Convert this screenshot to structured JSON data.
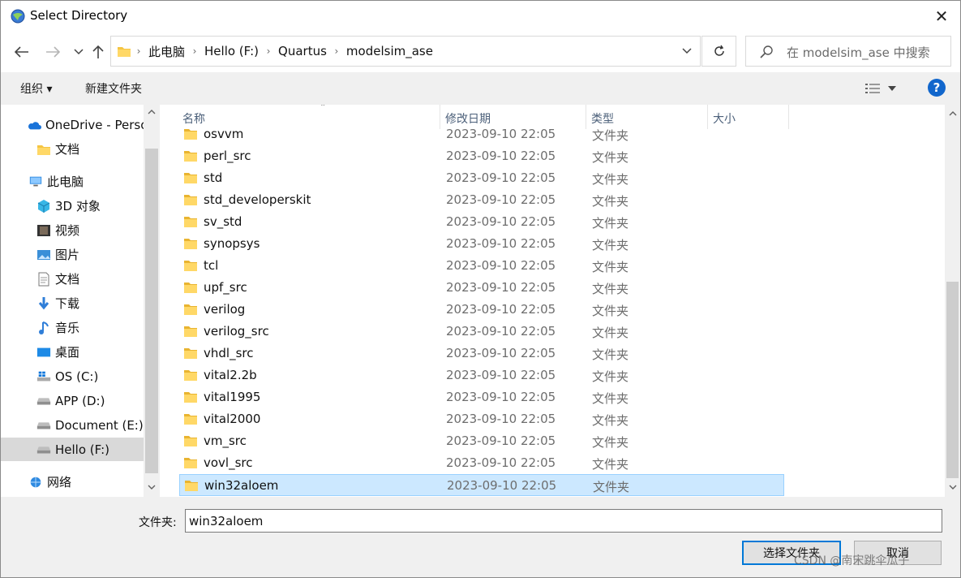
{
  "window": {
    "title": "Select Directory",
    "close_glyph": "✕"
  },
  "address": {
    "crumbs": [
      "此电脑",
      "Hello (F:)",
      "Quartus",
      "modelsim_ase"
    ],
    "separator": "›"
  },
  "search": {
    "placeholder": "在 modelsim_ase 中搜索"
  },
  "command_bar": {
    "organize_label": "组织 ▾",
    "new_folder_label": "新建文件夹",
    "help_glyph": "?"
  },
  "sidebar": {
    "items": [
      {
        "label": "OneDrive - Perso",
        "icon": "onedrive-icon"
      },
      {
        "label": "文档",
        "icon": "folder-icon"
      },
      {
        "label": "此电脑",
        "icon": "this-pc-icon"
      },
      {
        "label": "3D 对象",
        "icon": "3d-objects-icon"
      },
      {
        "label": "视频",
        "icon": "videos-icon"
      },
      {
        "label": "图片",
        "icon": "pictures-icon"
      },
      {
        "label": "文档",
        "icon": "documents-icon"
      },
      {
        "label": "下载",
        "icon": "downloads-icon"
      },
      {
        "label": "音乐",
        "icon": "music-icon"
      },
      {
        "label": "桌面",
        "icon": "desktop-icon"
      },
      {
        "label": "OS (C:)",
        "icon": "windows-drive-icon"
      },
      {
        "label": "APP (D:)",
        "icon": "drive-icon"
      },
      {
        "label": "Document (E:)",
        "icon": "drive-icon"
      },
      {
        "label": "Hello (F:)",
        "icon": "drive-icon",
        "selected": true
      },
      {
        "label": "网络",
        "icon": "network-icon"
      }
    ]
  },
  "columns": {
    "name": "名称",
    "date": "修改日期",
    "type": "类型",
    "size": "大小"
  },
  "files": [
    {
      "name": "osvvm",
      "date": "2023-09-10 22:05",
      "type": "文件夹"
    },
    {
      "name": "perl_src",
      "date": "2023-09-10 22:05",
      "type": "文件夹"
    },
    {
      "name": "std",
      "date": "2023-09-10 22:05",
      "type": "文件夹"
    },
    {
      "name": "std_developerskit",
      "date": "2023-09-10 22:05",
      "type": "文件夹"
    },
    {
      "name": "sv_std",
      "date": "2023-09-10 22:05",
      "type": "文件夹"
    },
    {
      "name": "synopsys",
      "date": "2023-09-10 22:05",
      "type": "文件夹"
    },
    {
      "name": "tcl",
      "date": "2023-09-10 22:05",
      "type": "文件夹"
    },
    {
      "name": "upf_src",
      "date": "2023-09-10 22:05",
      "type": "文件夹"
    },
    {
      "name": "verilog",
      "date": "2023-09-10 22:05",
      "type": "文件夹"
    },
    {
      "name": "verilog_src",
      "date": "2023-09-10 22:05",
      "type": "文件夹"
    },
    {
      "name": "vhdl_src",
      "date": "2023-09-10 22:05",
      "type": "文件夹"
    },
    {
      "name": "vital2.2b",
      "date": "2023-09-10 22:05",
      "type": "文件夹"
    },
    {
      "name": "vital1995",
      "date": "2023-09-10 22:05",
      "type": "文件夹"
    },
    {
      "name": "vital2000",
      "date": "2023-09-10 22:05",
      "type": "文件夹"
    },
    {
      "name": "vm_src",
      "date": "2023-09-10 22:05",
      "type": "文件夹"
    },
    {
      "name": "vovl_src",
      "date": "2023-09-10 22:05",
      "type": "文件夹"
    },
    {
      "name": "win32aloem",
      "date": "2023-09-10 22:05",
      "type": "文件夹",
      "selected": true
    }
  ],
  "bottom": {
    "folder_label": "文件夹:",
    "folder_value": "win32aloem",
    "select_button": "选择文件夹",
    "cancel_button": "取消",
    "watermark": "CSDN @南宋跳伞瓜子"
  },
  "colors": {
    "selection_bg": "#cce8ff",
    "selection_border": "#99d1ff",
    "accent": "#0078d7",
    "folder": "#f5c542"
  }
}
